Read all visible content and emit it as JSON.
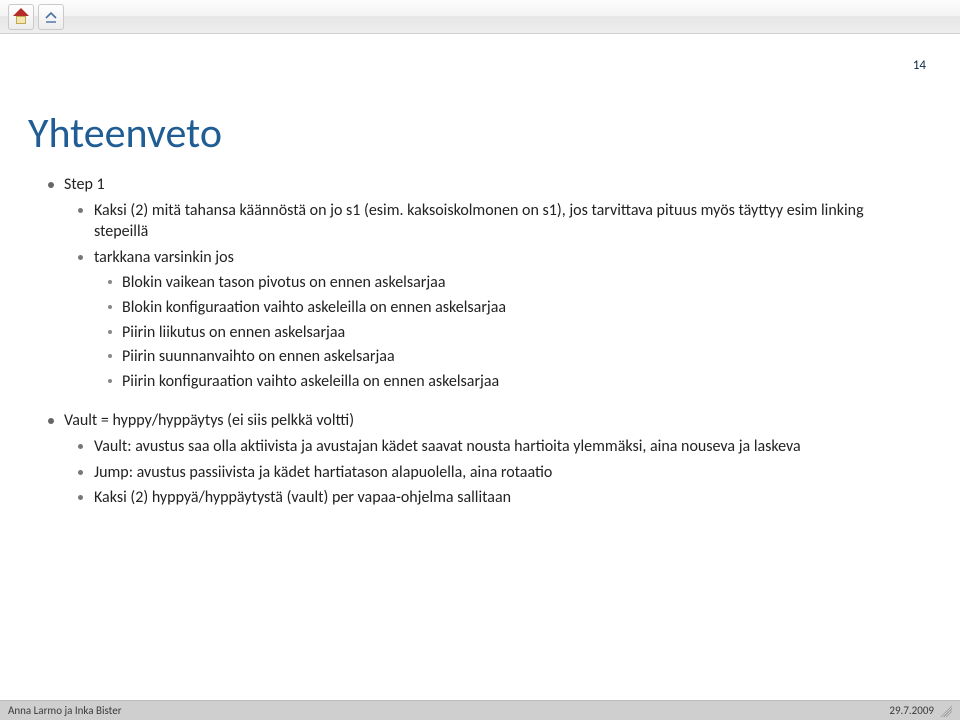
{
  "page_number": "14",
  "title": "Yhteenveto",
  "bullets_l0": [
    {
      "text": "Step 1",
      "children": [
        {
          "text": "Kaksi (2) mitä tahansa käännöstä on jo s1 (esim. kaksoiskolmonen on s1), jos tarvittava pituus myös täyttyy esim linking stepeillä"
        },
        {
          "text": "tarkkana varsinkin jos",
          "children": [
            {
              "text": "Blokin vaikean tason pivotus on ennen askelsarjaa"
            },
            {
              "text": "Blokin konfiguraation vaihto askeleilla on ennen askelsarjaa"
            },
            {
              "text": "Piirin liikutus on ennen askelsarjaa"
            },
            {
              "text": "Piirin suunnanvaihto on ennen askelsarjaa"
            },
            {
              "text": "Piirin konfiguraation vaihto askeleilla on ennen askelsarjaa"
            }
          ]
        }
      ]
    },
    {
      "text": "Vault = hyppy/hyppäytys (ei siis pelkkä voltti)",
      "children": [
        {
          "text": "Vault: avustus saa olla aktiivista ja avustajan kädet saavat nousta hartioita ylemmäksi, aina nouseva ja laskeva"
        },
        {
          "text": "Jump: avustus passiivista ja kädet hartiatason alapuolella, aina rotaatio"
        },
        {
          "text": "Kaksi (2) hyppyä/hyppäytystä (vault) per vapaa-ohjelma sallitaan"
        }
      ]
    }
  ],
  "footer": {
    "left": "Anna Larmo ja Inka Bister",
    "right": "29.7.2009"
  },
  "toolbar": {
    "home": "home",
    "collapse": "collapse"
  }
}
